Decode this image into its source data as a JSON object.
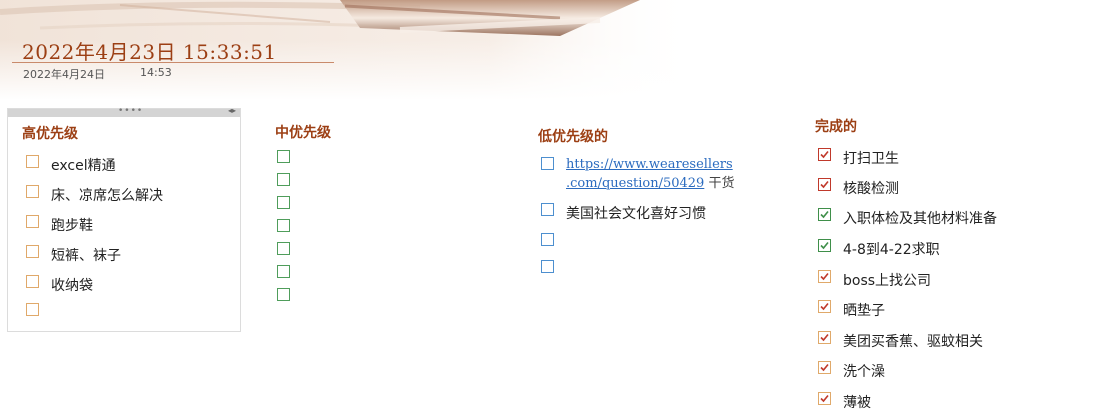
{
  "header": {
    "title_datetime": "2022年4月23日  15:33:51",
    "sub_date": "2022年4月24日",
    "sub_time": "14:53"
  },
  "columns": {
    "high": {
      "title": "高优先级",
      "items": [
        {
          "label": "excel精通",
          "checked": false
        },
        {
          "label": "床、凉席怎么解决",
          "checked": false
        },
        {
          "label": "跑步鞋",
          "checked": false
        },
        {
          "label": "短裤、袜子",
          "checked": false
        },
        {
          "label": "收纳袋",
          "checked": false
        },
        {
          "label": "",
          "checked": false
        }
      ]
    },
    "mid": {
      "title": "中优先级",
      "items": [
        {
          "label": "",
          "checked": false
        },
        {
          "label": "",
          "checked": false
        },
        {
          "label": "",
          "checked": false
        },
        {
          "label": "",
          "checked": false
        },
        {
          "label": "",
          "checked": false
        },
        {
          "label": "",
          "checked": false
        },
        {
          "label": "",
          "checked": false
        }
      ]
    },
    "low": {
      "title": "低优先级的",
      "items": [
        {
          "link_line1": "https://www.wearesellers",
          "link_line2": ".com/question/50429",
          "extra": " 干货",
          "checked": false
        },
        {
          "label": "美国社会文化喜好习惯",
          "checked": false
        },
        {
          "label": "",
          "checked": false
        },
        {
          "label": "",
          "checked": false
        }
      ]
    },
    "done": {
      "title": "完成的",
      "items": [
        {
          "label": "打扫卫生",
          "checked": true
        },
        {
          "label": "核酸检测",
          "checked": true
        },
        {
          "label": "入职体检及其他材料准备",
          "checked": true
        },
        {
          "label": "4-8到4-22求职",
          "checked": true
        },
        {
          "label": "boss上找公司",
          "checked": true
        },
        {
          "label": "晒垫子",
          "checked": true
        },
        {
          "label": "美团买香蕉、驱蚊相关",
          "checked": true
        },
        {
          "label": "洗个澡",
          "checked": true
        },
        {
          "label": "薄被",
          "checked": true
        }
      ]
    }
  },
  "colors": {
    "accent": "#9c3f14",
    "check_red": "#c0392b",
    "check_green": "#3f8f4a",
    "link": "#2b6bbf"
  },
  "icons": {
    "drag_handle": "drag-handle-icon",
    "resize": "resize-arrows-icon",
    "checkmark": "checkmark-icon"
  }
}
